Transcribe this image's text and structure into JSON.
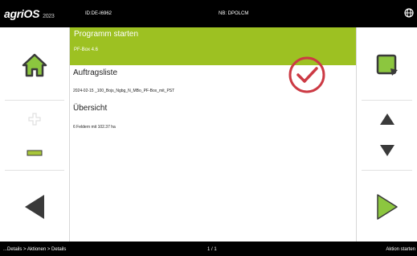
{
  "topbar": {
    "brand": "agriOS",
    "version": "2023",
    "id_text": "ID:DE-I6962",
    "nb_text": "NB: DPOLCM"
  },
  "main": {
    "title": "Programm starten",
    "subtitle": "PF-Box 4.6",
    "auftragsliste_label": "Auftragsliste",
    "auftrag_line": "2024-02-15 _100_Bojs_Ngbg_N_MBo_PF-Box_mit_PST",
    "uebersicht_label": "Übersicht",
    "uebersicht_line": "6 Feldern mit 102.37 ha"
  },
  "bottombar": {
    "path": "...Details > Aktionen > Details",
    "page": "1 / 1",
    "right": "Aktion starten"
  },
  "colors": {
    "accent_green": "#9dc122",
    "check_red": "#cc3a44",
    "button_green": "#8cc63f",
    "dark_icon": "#3a3a3a"
  },
  "icons": {
    "home": "home-icon",
    "plus": "plus-icon",
    "minus": "minus-icon",
    "back": "arrow-left-icon",
    "confirm": "confirm-export-icon",
    "up": "arrow-up-icon",
    "down": "arrow-down-icon",
    "next": "arrow-right-icon",
    "check": "checkmark-circle-icon",
    "globe": "globe-icon"
  }
}
